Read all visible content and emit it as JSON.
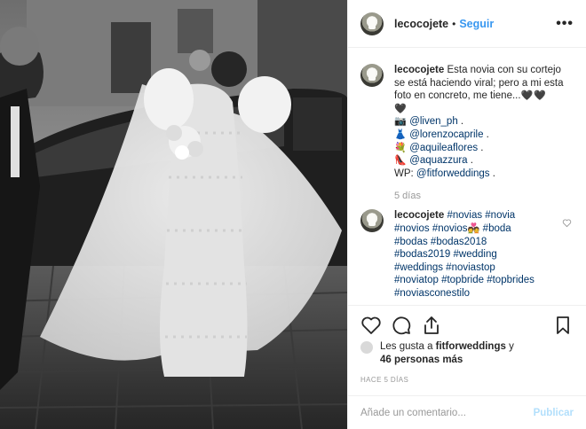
{
  "header": {
    "username": "lecocojete",
    "separator": "•",
    "follow_label": "Seguir",
    "more_label": "•••"
  },
  "caption": {
    "username": "lecocojete",
    "text_line1": "Esta novia con su cortejo",
    "text_line2": "se está haciendo viral; pero a mi esta",
    "text_line3": "foto en concreto, me tiene...",
    "hearts_inline": "🖤🖤",
    "hearts_line4": "🖤",
    "credits": [
      {
        "emoji": "📷",
        "handle": "@liven_ph",
        "suffix": " ."
      },
      {
        "emoji": "👗",
        "handle": "@lorenzocaprile",
        "suffix": " ."
      },
      {
        "emoji": "💐",
        "handle": "@aquileaflores",
        "suffix": " ."
      },
      {
        "emoji": "👠",
        "handle": "@aquazzura",
        "suffix": " ."
      }
    ],
    "wp_prefix": "WP: ",
    "wp_handle": "@fitforweddings",
    "wp_suffix": " ."
  },
  "caption_time": "5 días",
  "comment": {
    "username": "lecocojete",
    "hashtags_line1": "#novias #novia",
    "hashtags_line2a": "#novios #novios",
    "hashtags_line2_emoji": "💑",
    "hashtags_line2b": " #boda",
    "hashtags_line3": "#bodas #bodas2018",
    "hashtags_line4": "#bodas2019 #wedding",
    "hashtags_line5": "#weddings #noviastop",
    "hashtags_line6": "#noviatop #topbride #topbrides",
    "hashtags_line7": "#noviasconestilo"
  },
  "likes": {
    "prefix": "Les gusta a ",
    "user": "fitforweddings",
    "mid": " y",
    "count": "46 personas más"
  },
  "posted_ago": "HACE 5 DÍAS",
  "add_comment": {
    "placeholder": "Añade un comentario...",
    "publish_label": "Publicar"
  },
  "colors": {
    "link": "#003569",
    "follow": "#3897f0",
    "muted": "#999999",
    "publish_disabled": "#b2dffc",
    "border": "#efefef"
  },
  "icons": [
    "more-icon",
    "heart-icon",
    "comment-icon",
    "share-icon",
    "bookmark-icon",
    "comment-like-icon"
  ]
}
